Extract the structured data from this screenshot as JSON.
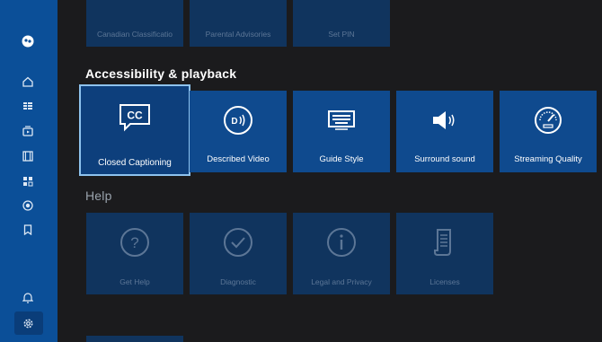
{
  "colors": {
    "sidebar": "#0b4f98",
    "tile": "#0f4a8e",
    "tile_dim": "#10345e",
    "focus_outline": "#8ec3ee",
    "background": "#1b1b1d"
  },
  "sidebar": {
    "items": [
      {
        "icon": "profile-icon"
      },
      {
        "icon": "home-icon"
      },
      {
        "icon": "guide-icon"
      },
      {
        "icon": "tv-icon"
      },
      {
        "icon": "movies-icon"
      },
      {
        "icon": "apps-icon"
      },
      {
        "icon": "recordings-icon"
      },
      {
        "icon": "bookmark-icon"
      },
      {
        "icon": "bell-icon"
      },
      {
        "icon": "settings-icon",
        "selected": true
      }
    ]
  },
  "top_row": {
    "tiles": [
      {
        "label": "Canadian Classificatio"
      },
      {
        "label": "Parental Advisories"
      },
      {
        "label": "Set PIN"
      }
    ]
  },
  "accessibility": {
    "title": "Accessibility & playback",
    "tiles": [
      {
        "label": "Closed Captioning",
        "icon": "closed-captioning-icon",
        "focused": true
      },
      {
        "label": "Described Video",
        "icon": "described-video-icon"
      },
      {
        "label": "Guide Style",
        "icon": "keyboard-icon"
      },
      {
        "label": "Surround sound",
        "icon": "speaker-icon"
      },
      {
        "label": "Streaming Quality",
        "icon": "gauge-icon"
      }
    ]
  },
  "help": {
    "title": "Help",
    "tiles": [
      {
        "label": "Get Help",
        "icon": "question-icon"
      },
      {
        "label": "Diagnostic",
        "icon": "check-icon"
      },
      {
        "label": "Legal and Privacy",
        "icon": "info-icon"
      },
      {
        "label": "Licenses",
        "icon": "document-icon"
      }
    ]
  }
}
